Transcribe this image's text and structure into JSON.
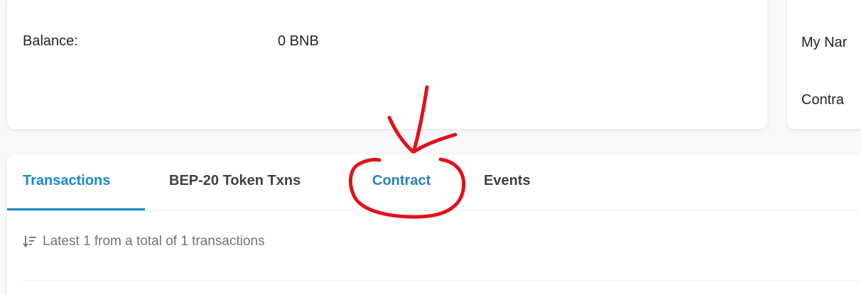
{
  "overview": {
    "balance_label": "Balance:",
    "balance_value": "0 BNB"
  },
  "more_info": {
    "name_label": "My Nar",
    "contract_label": "Contra"
  },
  "tabs": [
    {
      "label": "Transactions",
      "active": true
    },
    {
      "label": "BEP-20 Token Txns",
      "active": false
    },
    {
      "label": "Contract",
      "active": false
    },
    {
      "label": "Events",
      "active": false
    }
  ],
  "summary": {
    "text": "Latest 1 from a total of 1 transactions",
    "icon": "sort-icon"
  },
  "colors": {
    "accent": "#1c87c9",
    "annotation": "#e3101a"
  }
}
